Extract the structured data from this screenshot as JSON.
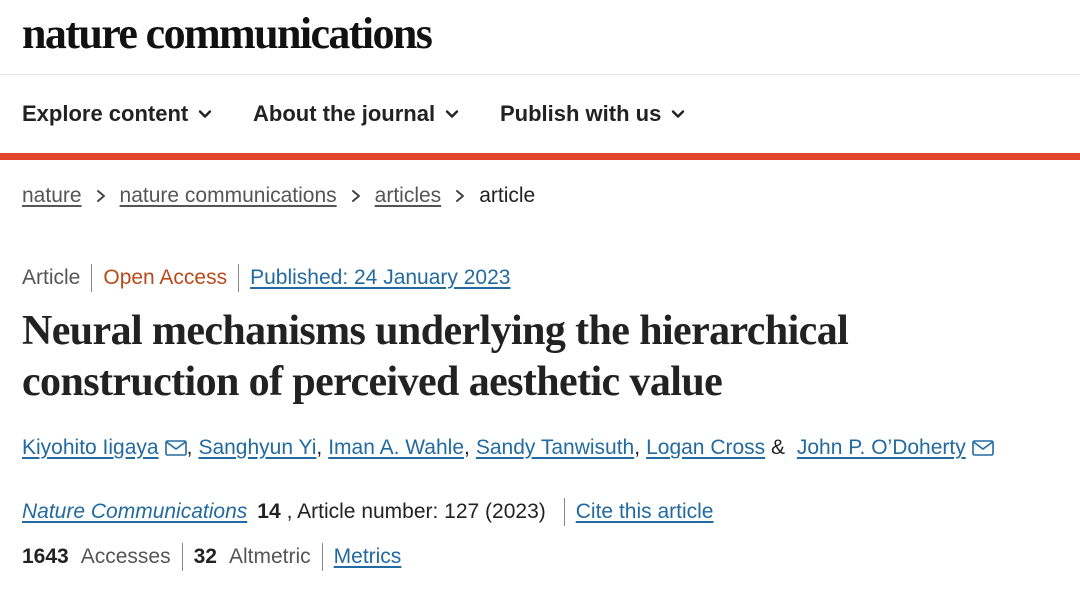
{
  "header": {
    "logo": "nature communications"
  },
  "nav": {
    "items": [
      {
        "label": "Explore content"
      },
      {
        "label": "About the journal"
      },
      {
        "label": "Publish with us"
      }
    ]
  },
  "breadcrumb": {
    "items": [
      "nature",
      "nature communications",
      "articles"
    ],
    "current": "article"
  },
  "article_meta": {
    "type": "Article",
    "access": "Open Access",
    "published": "Published: 24 January 2023"
  },
  "title": "Neural mechanisms underlying the hierarchical construction of perceived aesthetic value",
  "authors": [
    {
      "name": "Kiyohito Iigaya",
      "mail": true,
      "sep": ", "
    },
    {
      "name": "Sanghyun Yi",
      "mail": false,
      "sep": ", "
    },
    {
      "name": "Iman A. Wahle",
      "mail": false,
      "sep": ", "
    },
    {
      "name": "Sandy Tanwisuth",
      "mail": false,
      "sep": ", "
    },
    {
      "name": "Logan Cross",
      "mail": false,
      "sep": " & "
    },
    {
      "name": "John P. O’Doherty",
      "mail": true,
      "sep": ""
    }
  ],
  "citation": {
    "journal": "Nature Communications",
    "volume": "14",
    "article_number": ", Article number: 127 (2023)",
    "cite_link": "Cite this article"
  },
  "stats": {
    "accesses_value": "1643",
    "accesses_label": "Accesses",
    "altmetric_value": "32",
    "altmetric_label": "Altmetric",
    "metrics_link": "Metrics"
  },
  "colors": {
    "accent_bar": "#e0452c",
    "link": "#226aa0",
    "open_access": "#b84a1a"
  }
}
